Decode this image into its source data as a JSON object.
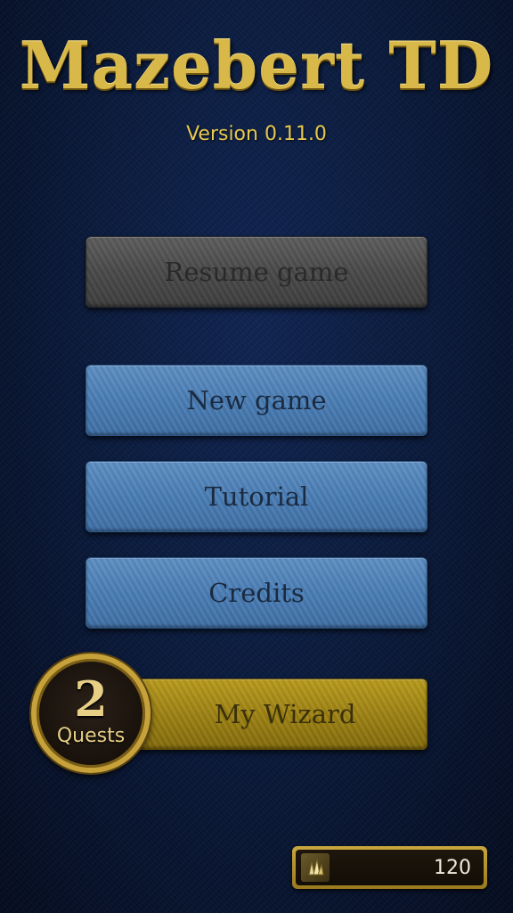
{
  "title": "Mazebert TD",
  "version": "Version 0.11.0",
  "menu": {
    "resume": "Resume game",
    "new_game": "New game",
    "tutorial": "Tutorial",
    "credits": "Credits",
    "my_wizard": "My Wizard"
  },
  "quests": {
    "count": "2",
    "label": "Quests"
  },
  "currency": {
    "icon": "crystal-icon",
    "value": "120"
  },
  "colors": {
    "gold": "#d9b84a",
    "blue_button": "#4a7db4",
    "gray_button": "#4a4a4a",
    "gold_button": "#9a7f12"
  }
}
